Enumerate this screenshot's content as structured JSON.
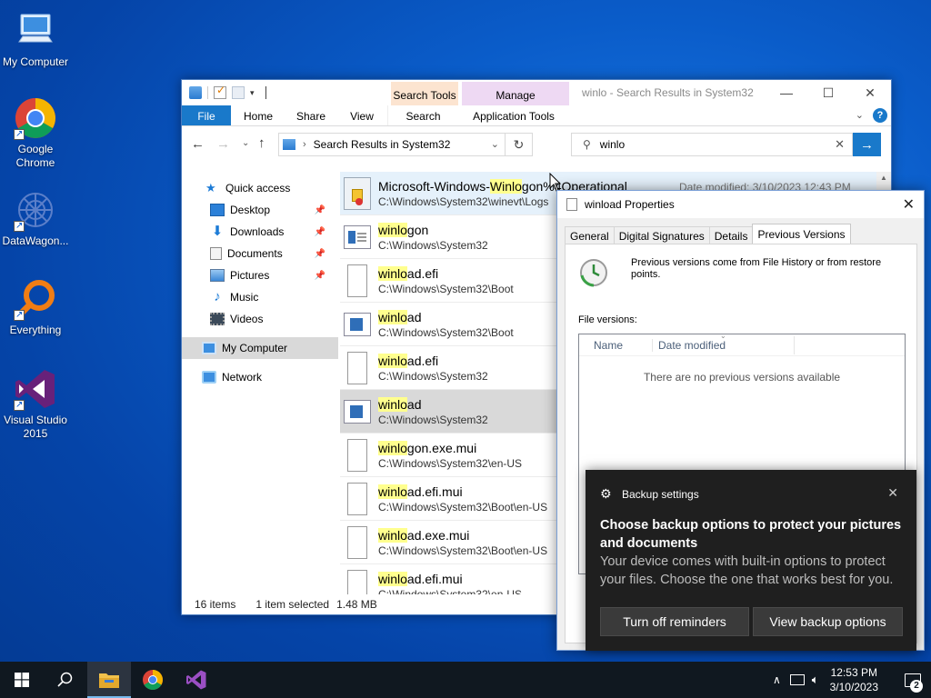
{
  "desktop": {
    "icons": [
      {
        "label": "My Computer",
        "icon": "computer-icon"
      },
      {
        "label": "Google Chrome",
        "icon": "chrome-icon"
      },
      {
        "label": "DataWagon...",
        "icon": "datawagon-icon"
      },
      {
        "label": "Everything",
        "icon": "everything-search-icon"
      },
      {
        "label": "Visual Studio 2015",
        "icon": "visual-studio-icon"
      }
    ]
  },
  "explorer": {
    "title": "winlo - Search Results in System32",
    "context_tabs": {
      "search_tools": "Search Tools",
      "manage": "Manage"
    },
    "ribbon_tabs": {
      "file": "File",
      "home": "Home",
      "share": "Share",
      "view": "View",
      "search": "Search",
      "application_tools": "Application Tools"
    },
    "address": "Search Results in System32",
    "search_value": "winlo",
    "nav": {
      "quick_access": "Quick access",
      "desktop": "Desktop",
      "downloads": "Downloads",
      "documents": "Documents",
      "pictures": "Pictures",
      "music": "Music",
      "videos": "Videos",
      "my_computer": "My Computer",
      "network": "Network"
    },
    "results": [
      {
        "pre": "Microsoft-Windows-",
        "hl": "Winlo",
        "post": "gon%4Operational",
        "path": "C:\\Windows\\System32\\winevt\\Logs",
        "modified": "Date modified: 3/10/2023 12:43 PM"
      },
      {
        "pre": "",
        "hl": "winlo",
        "post": "gon",
        "path": "C:\\Windows\\System32"
      },
      {
        "pre": "",
        "hl": "winlo",
        "post": "ad.efi",
        "path": "C:\\Windows\\System32\\Boot"
      },
      {
        "pre": "",
        "hl": "winlo",
        "post": "ad",
        "path": "C:\\Windows\\System32\\Boot"
      },
      {
        "pre": "",
        "hl": "winlo",
        "post": "ad.efi",
        "path": "C:\\Windows\\System32"
      },
      {
        "pre": "",
        "hl": "winlo",
        "post": "ad",
        "path": "C:\\Windows\\System32"
      },
      {
        "pre": "",
        "hl": "winlo",
        "post": "gon.exe.mui",
        "path": "C:\\Windows\\System32\\en-US"
      },
      {
        "pre": "",
        "hl": "winlo",
        "post": "ad.efi.mui",
        "path": "C:\\Windows\\System32\\Boot\\en-US"
      },
      {
        "pre": "",
        "hl": "winlo",
        "post": "ad.exe.mui",
        "path": "C:\\Windows\\System32\\Boot\\en-US"
      },
      {
        "pre": "",
        "hl": "winlo",
        "post": "ad.efi.mui",
        "path": "C:\\Windows\\System32\\en-US"
      }
    ],
    "status": {
      "count": "16 items",
      "selected": "1 item selected",
      "size": "1.48 MB"
    }
  },
  "properties": {
    "title": "winload Properties",
    "tabs": {
      "general": "General",
      "digital_signatures": "Digital Signatures",
      "details": "Details",
      "previous_versions": "Previous Versions"
    },
    "info": "Previous versions come from File History or from restore points.",
    "file_versions_label": "File versions:",
    "columns": {
      "name": "Name",
      "date_modified": "Date modified"
    },
    "empty_text": "There are no previous versions available"
  },
  "toast": {
    "app": "Backup settings",
    "heading": "Choose backup options to protect your pictures and documents",
    "body": "Your device comes with built-in options to protect your files. Choose the one that works best for you.",
    "btn_off": "Turn off reminders",
    "btn_view": "View backup options"
  },
  "taskbar": {
    "time": "12:53 PM",
    "date": "3/10/2023",
    "notification_count": "2"
  }
}
